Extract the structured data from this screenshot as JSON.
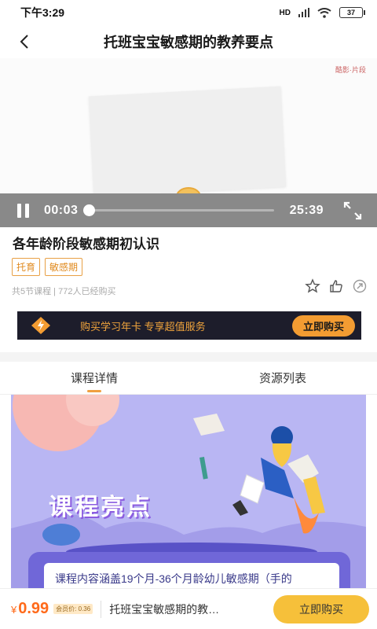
{
  "status_bar": {
    "time": "下午3:29",
    "signal": "HD",
    "battery": "37"
  },
  "nav": {
    "title": "托班宝宝敏感期的教养要点"
  },
  "video": {
    "current_time": "00:03",
    "total_time": "25:39",
    "progress": 0.002,
    "logo_text": "酷影·片段"
  },
  "course": {
    "title": "各年龄阶段敏感期初认识",
    "tags": [
      "托育",
      "敏感期"
    ],
    "meta": "共5节课程 | 772人已经购买"
  },
  "banner": {
    "text": "购买学习年卡 专享超值服务",
    "button": "立即购买"
  },
  "tabs": [
    {
      "label": "课程详情",
      "active": true
    },
    {
      "label": "资源列表",
      "active": false
    }
  ],
  "poster": {
    "title": "课程亮点",
    "description": "课程内容涵盖19个月-36个月龄幼儿敏感期（手的"
  },
  "bottom_bar": {
    "currency": "¥",
    "price": "0.99",
    "member_price": "会员价: 0.36",
    "title": "托班宝宝敏感期的教…",
    "buy_button": "立即购买"
  },
  "colors": {
    "accent": "#f39c32",
    "price": "#ff6a1a",
    "poster_bg": "#b9b6f3",
    "buy_button": "#f6c03a"
  }
}
